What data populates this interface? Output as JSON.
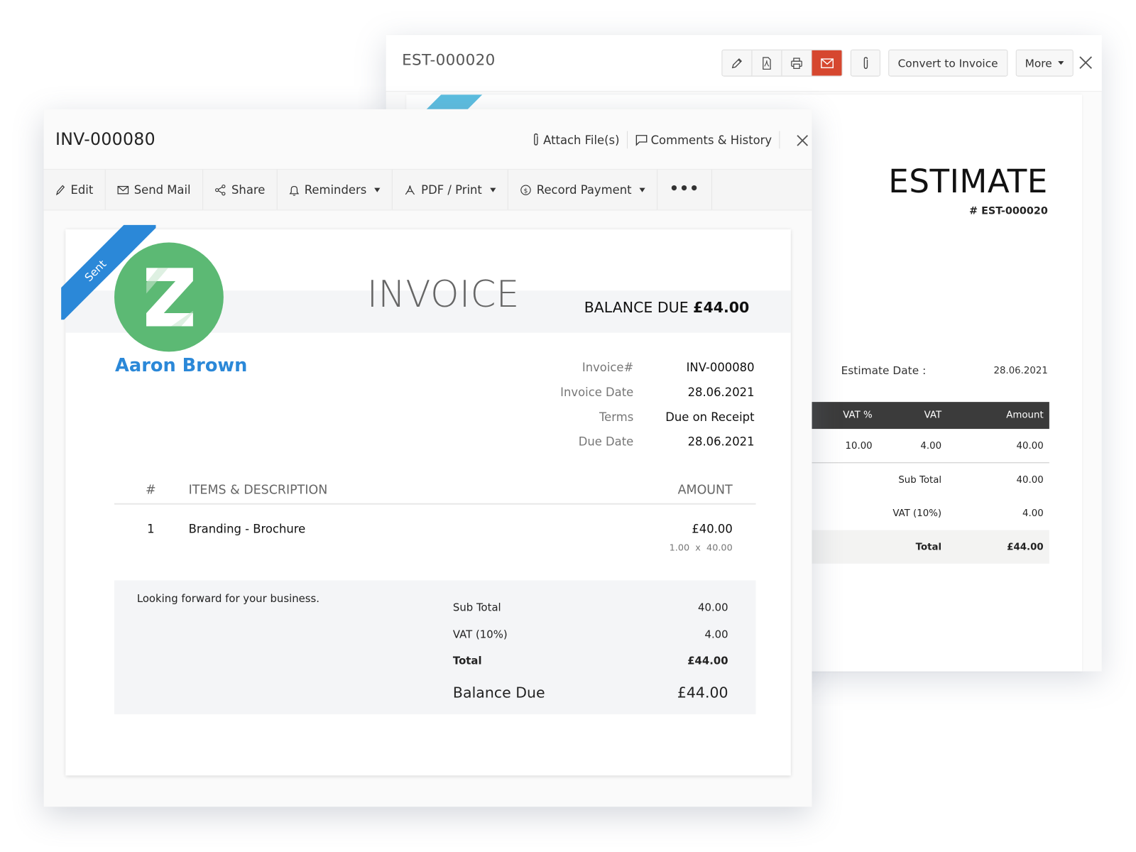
{
  "estimate_window": {
    "title": "EST-000020",
    "toolbar": {
      "icons": [
        "pencil-icon",
        "pdf-icon",
        "print-icon",
        "mail-icon",
        "paperclip-icon"
      ],
      "convert_label": "Convert to Invoice",
      "more_label": "More",
      "accent_color": "#d6472f"
    },
    "document": {
      "heading": "ESTIMATE",
      "number": "# EST-000020",
      "date_label": "Estimate Date :",
      "date_value": "28.06.2021",
      "table": {
        "headers": [
          "VAT %",
          "VAT",
          "Amount"
        ],
        "rows": [
          [
            "10.00",
            "4.00",
            "40.00"
          ]
        ],
        "summary": [
          {
            "label": "Sub Total",
            "value": "40.00"
          },
          {
            "label": "VAT (10%)",
            "value": "4.00"
          },
          {
            "label": "Total",
            "value": "£44.00"
          }
        ]
      }
    }
  },
  "invoice_window": {
    "title": "INV-000080",
    "header_actions": {
      "attach": "Attach File(s)",
      "comments": "Comments & History"
    },
    "toolbar": [
      {
        "label": "Edit",
        "icon": "pencil-icon"
      },
      {
        "label": "Send Mail",
        "icon": "mail-icon"
      },
      {
        "label": "Share",
        "icon": "share-icon"
      },
      {
        "label": "Reminders",
        "icon": "bell-icon",
        "dropdown": true
      },
      {
        "label": "PDF / Print",
        "icon": "pdf-icon",
        "dropdown": true
      },
      {
        "label": "Record Payment",
        "icon": "payment-icon",
        "dropdown": true
      },
      {
        "label": "•••",
        "icon": "more-icon"
      }
    ],
    "document": {
      "status_ribbon": "Sent",
      "ribbon_color": "#2b88d8",
      "logo_color": "#5cb974",
      "customer_name": "Aaron Brown",
      "heading": "INVOICE",
      "balance_due_label": "BALANCE DUE",
      "balance_due_amount": "£44.00",
      "meta": [
        {
          "label": "Invoice#",
          "value": "INV-000080"
        },
        {
          "label": "Invoice Date",
          "value": "28.06.2021"
        },
        {
          "label": "Terms",
          "value": "Due on Receipt"
        },
        {
          "label": "Due Date",
          "value": "28.06.2021"
        }
      ],
      "items_header": {
        "num": "#",
        "desc": "ITEMS & DESCRIPTION",
        "amount": "AMOUNT"
      },
      "items": [
        {
          "num": "1",
          "desc": "Branding - Brochure",
          "amount": "£40.00",
          "qty_rate": "1.00  x  40.00"
        }
      ],
      "notes": "Looking forward for your business.",
      "summary": [
        {
          "label": "Sub Total",
          "value": "40.00"
        },
        {
          "label": "VAT (10%)",
          "value": "4.00"
        },
        {
          "label": "Total",
          "value": "£44.00"
        },
        {
          "label": "Balance Due",
          "value": "£44.00"
        }
      ]
    }
  }
}
